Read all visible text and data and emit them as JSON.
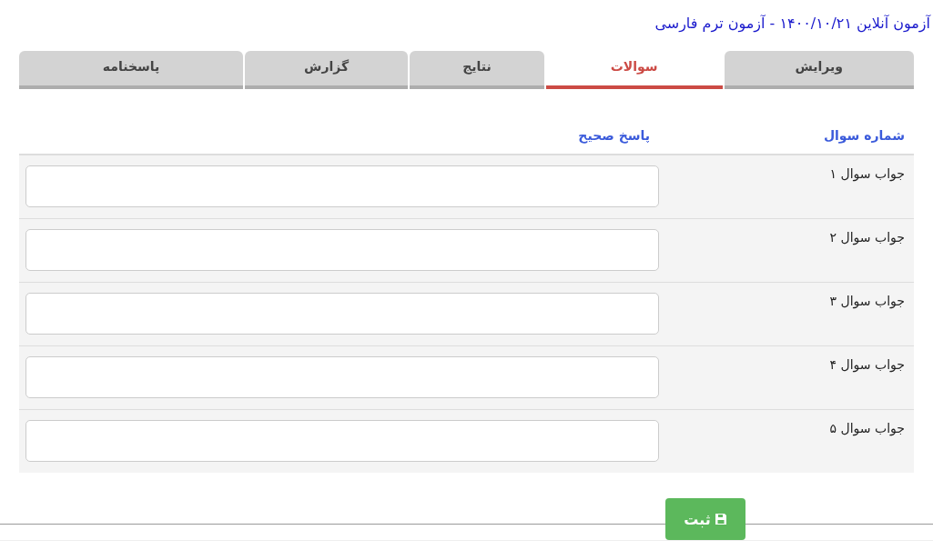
{
  "title": "آزمون آنلاین ۱۴۰۰/۱۰/۲۱ - آزمون ترم فارسی",
  "tabs": [
    {
      "label": "ویرایش",
      "selected": false
    },
    {
      "label": "سوالات",
      "selected": true
    },
    {
      "label": "نتایج",
      "selected": false
    },
    {
      "label": "گزارش",
      "selected": false
    },
    {
      "label": "پاسخنامه",
      "selected": false
    }
  ],
  "table": {
    "columns": [
      "شماره سوال",
      "پاسخ صحیح"
    ],
    "rows": [
      {
        "label": "جواب سوال ۱"
      },
      {
        "label": "جواب سوال ۲"
      },
      {
        "label": "جواب سوال ۳"
      },
      {
        "label": "جواب سوال ۴"
      },
      {
        "label": "جواب سوال ۵"
      }
    ]
  },
  "submit_button": {
    "label": "ثبت"
  }
}
